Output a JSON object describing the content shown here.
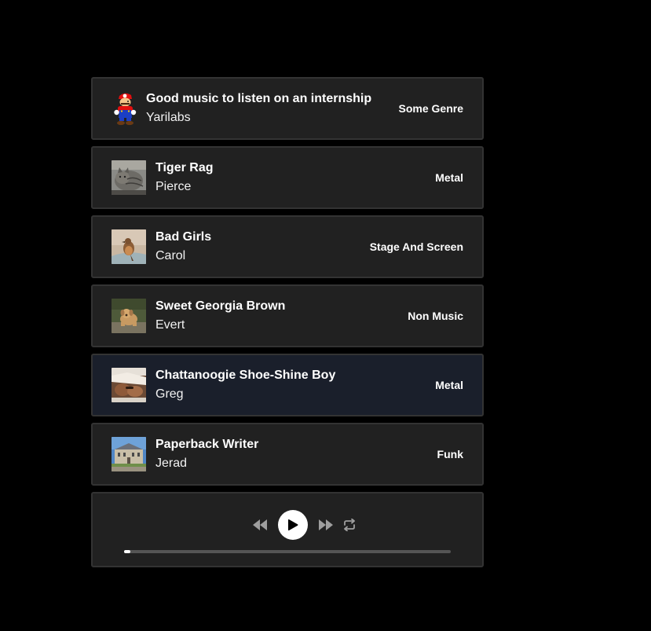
{
  "tracks": [
    {
      "title": "Good music to listen on an internship",
      "artist": "Yarilabs",
      "genre": "Some Genre",
      "thumbnail": "mario-mascot-icon",
      "active": false
    },
    {
      "title": "Tiger Rag",
      "artist": "Pierce",
      "genre": "Metal",
      "thumbnail": "cat-photo",
      "active": false
    },
    {
      "title": "Bad Girls",
      "artist": "Carol",
      "genre": "Stage And Screen",
      "thumbnail": "bird-photo",
      "active": false
    },
    {
      "title": "Sweet Georgia Brown",
      "artist": "Evert",
      "genre": "Non Music",
      "thumbnail": "dog-photo",
      "active": false
    },
    {
      "title": "Chattanoogie Shoe-Shine Boy",
      "artist": "Greg",
      "genre": "Metal",
      "thumbnail": "hands-photo",
      "active": true
    },
    {
      "title": "Paperback Writer",
      "artist": "Jerad",
      "genre": "Funk",
      "thumbnail": "building-photo",
      "active": false
    }
  ],
  "player": {
    "controls": [
      "rewind-icon",
      "play-icon",
      "fast-forward-icon",
      "repeat-icon"
    ],
    "progress": 0.02
  },
  "colors": {
    "background": "#000000",
    "card": "#212121",
    "card_active": "#1a1f2b",
    "border": "#333333",
    "text": "#ffffff",
    "icon_muted": "#9e9e9e"
  }
}
